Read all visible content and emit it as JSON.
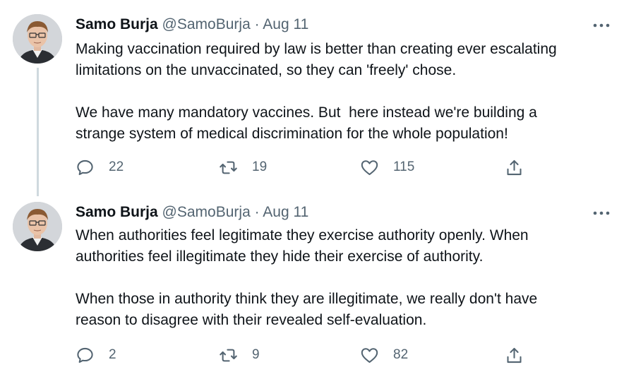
{
  "tweets": [
    {
      "author_name": "Samo Burja",
      "handle": "@SamoBurja",
      "separator": "·",
      "date": "Aug 11",
      "text": "Making vaccination required by law is better than creating ever escalating\nlimitations on the unvaccinated, so they can 'freely' chose.\n\nWe have many mandatory vaccines. But  here instead we're building a\nstrange system of medical discrimination for the whole population!",
      "replies": "22",
      "retweets": "19",
      "likes": "115"
    },
    {
      "author_name": "Samo Burja",
      "handle": "@SamoBurja",
      "separator": "·",
      "date": "Aug 11",
      "text": "When authorities feel legitimate they exercise authority openly. When\nauthorities feel illegitimate they hide their exercise of authority.\n\nWhen those in authority think they are illegitimate, we really don't have\nreason to disagree with their revealed self-evaluation.",
      "replies": "2",
      "retweets": "9",
      "likes": "82"
    }
  ],
  "icons": {
    "more": "more-horizontal-icon",
    "reply": "reply-icon",
    "retweet": "retweet-icon",
    "like": "heart-icon",
    "share": "share-icon"
  },
  "colors": {
    "text": "#0f1419",
    "secondary": "#536471",
    "thread_line": "#cfd9de"
  }
}
